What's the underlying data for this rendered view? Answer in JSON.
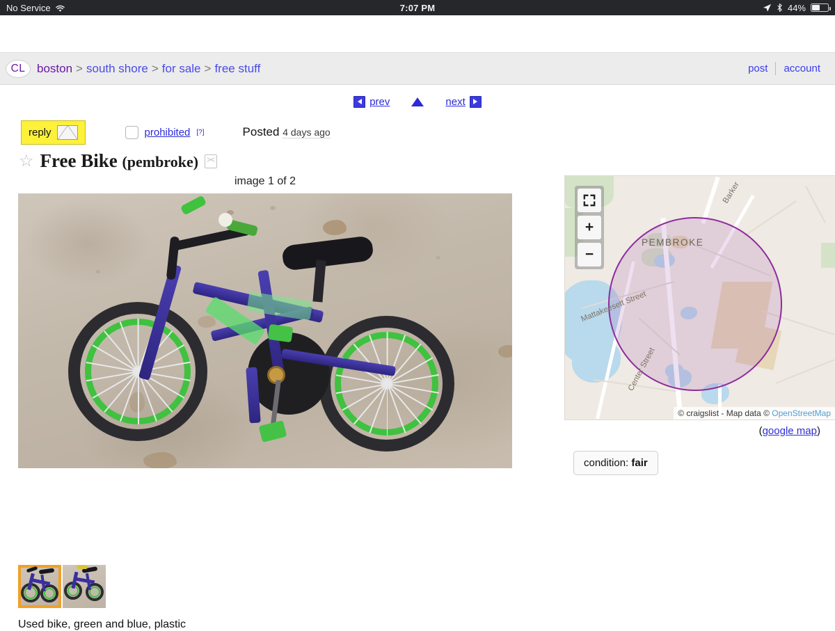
{
  "statusbar": {
    "carrier": "No Service",
    "wifi_icon": "wifi-icon",
    "time": "7:07 PM",
    "location_icon": "location-arrow-icon",
    "bluetooth_icon": "bluetooth-icon",
    "battery_percent": "44%",
    "battery_level": 44
  },
  "header": {
    "logo": "CL",
    "breadcrumbs": [
      {
        "label": "boston"
      },
      {
        "label": "south shore"
      },
      {
        "label": "for sale"
      },
      {
        "label": "free stuff"
      }
    ],
    "separator": ">",
    "post_label": "post",
    "account_label": "account"
  },
  "postnav": {
    "prev_label": "prev",
    "up_icon": "up-triangle-icon",
    "next_label": "next",
    "prev_icon": "left-triangle-icon",
    "next_icon": "right-triangle-icon"
  },
  "actions": {
    "reply_label": "reply",
    "envelope_icon": "envelope-icon",
    "prohibited_label": "prohibited",
    "prohibited_help": "[?]",
    "posted_label": "Posted",
    "posted_ago": "4 days ago"
  },
  "posting": {
    "favorite_icon": "star-icon",
    "title": "Free Bike",
    "location": "(pembroke)",
    "trash_icon": "trash-icon",
    "image_count_label": "image 1 of 2",
    "description": "Used bike, green and blue, plastic"
  },
  "map": {
    "city_label": "PEMBROKE",
    "streets": [
      {
        "name": "Barker"
      },
      {
        "name": "Mattakeesett Street"
      },
      {
        "name": "Center Street"
      }
    ],
    "fullscreen_icon": "fullscreen-icon",
    "zoom_in_label": "+",
    "zoom_out_label": "−",
    "attribution_prefix": "© craigslist - Map data © ",
    "attribution_link": "OpenStreetMap",
    "google_map_label": "google map",
    "google_map_open_paren": "(",
    "google_map_close_paren": ")",
    "circle_color": "#8d2b9e"
  },
  "attributes": {
    "condition_label": "condition:",
    "condition_value": "fair"
  },
  "thumbnails": [
    {
      "name": "thumbnail-1",
      "selected": true
    },
    {
      "name": "thumbnail-2",
      "selected": false
    }
  ],
  "colors": {
    "link": "#2b2bd8",
    "logo_purple": "#6b17a8",
    "reply_yellow": "#fdf139",
    "thumb_selected": "#f0a028",
    "header_bg": "#ececec"
  }
}
